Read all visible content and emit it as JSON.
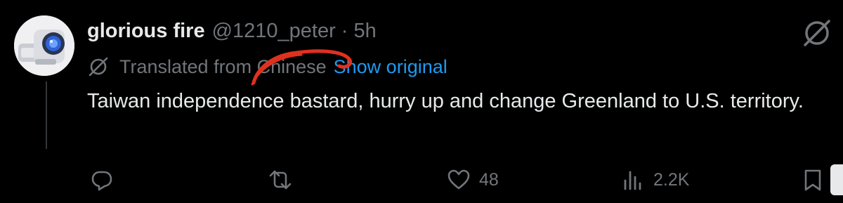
{
  "author": {
    "display_name": "glorious fire",
    "handle": "@1210_peter",
    "separator": "·",
    "time": "5h",
    "avatar_icon": "robot-camera-avatar"
  },
  "translation": {
    "label": "Translated from Chinese",
    "show_original": "Show original",
    "icon": "translate-globe-icon",
    "annotation_color": "#e0311f"
  },
  "tweet": {
    "text": "Taiwan independence bastard, hurry up and change Greenland to U.S. territory."
  },
  "actions": {
    "reply": {
      "icon": "reply-icon",
      "count": ""
    },
    "retweet": {
      "icon": "retweet-icon",
      "count": ""
    },
    "like": {
      "icon": "heart-icon",
      "count": "48"
    },
    "views": {
      "icon": "views-icon",
      "count": "2.2K"
    },
    "bookmark": {
      "icon": "bookmark-icon"
    }
  },
  "colors": {
    "background": "#000000",
    "text": "#e7e9ea",
    "muted": "#71767b",
    "link": "#1d9bf0"
  }
}
